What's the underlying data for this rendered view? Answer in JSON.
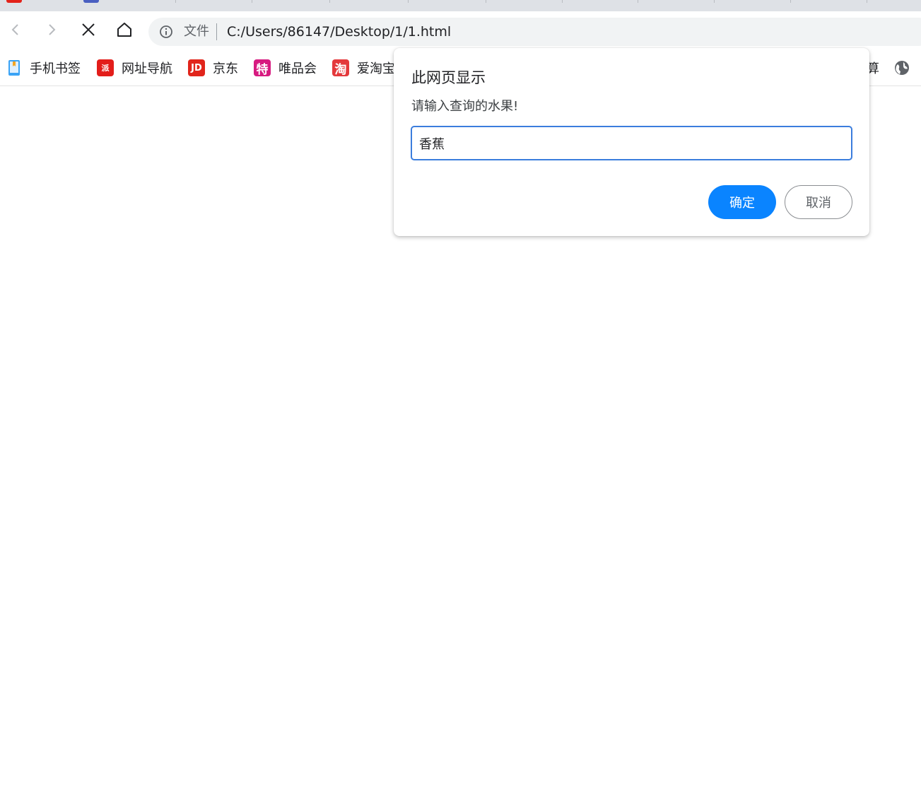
{
  "toolbar": {
    "scheme_chip": "文件",
    "url": "C:/Users/86147/Desktop/1/1.html"
  },
  "bookmarks": [
    {
      "label": "手机书签",
      "icon": "phone-bookmark-icon",
      "color": "#2d8cf0"
    },
    {
      "label": "网址导航",
      "icon": "nav-site-icon",
      "color": "#e31d1a"
    },
    {
      "label": "京东",
      "icon": "jd-icon",
      "color": "#e1251b",
      "glyph": "JD"
    },
    {
      "label": "唯品会",
      "icon": "vip-icon",
      "color": "#d71a80",
      "glyph": "特"
    },
    {
      "label": "爱淘宝",
      "icon": "taobao-icon",
      "color": "#e4393c",
      "glyph": "淘"
    },
    {
      "label": "算",
      "icon": "none"
    }
  ],
  "dialog": {
    "title": "此网页显示",
    "message": "请输入查询的水果!",
    "input_value": "香蕉",
    "ok_label": "确定",
    "cancel_label": "取消"
  },
  "colors": {
    "accent": "#0a84ff",
    "input_focus": "#3b7ddd",
    "tabstrip": "#dee1e6",
    "omnibox": "#f1f3f4"
  }
}
